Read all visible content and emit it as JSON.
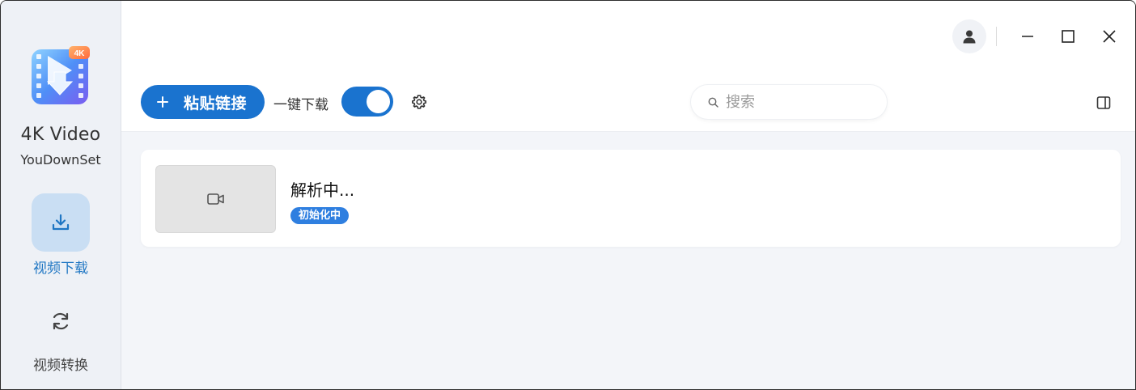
{
  "app": {
    "name_line1": "4K Video",
    "name_line2": "YouDownSet",
    "logo_badge": "4K"
  },
  "sidebar": {
    "items": [
      {
        "label": "视频下载",
        "icon": "download-icon",
        "active": true
      },
      {
        "label": "视频转换",
        "icon": "refresh-icon",
        "active": false
      }
    ]
  },
  "toolbar": {
    "paste_label": "粘贴链接",
    "oneclick_label": "一键下载",
    "oneclick_enabled": true,
    "search_placeholder": "搜索"
  },
  "tasks": [
    {
      "title": "解析中...",
      "status": "初始化中"
    }
  ],
  "colors": {
    "accent": "#1a73cf",
    "badge": "#2f7fe0",
    "sidebar_bg": "#eef1f6",
    "content_bg": "#f3f5f9"
  }
}
